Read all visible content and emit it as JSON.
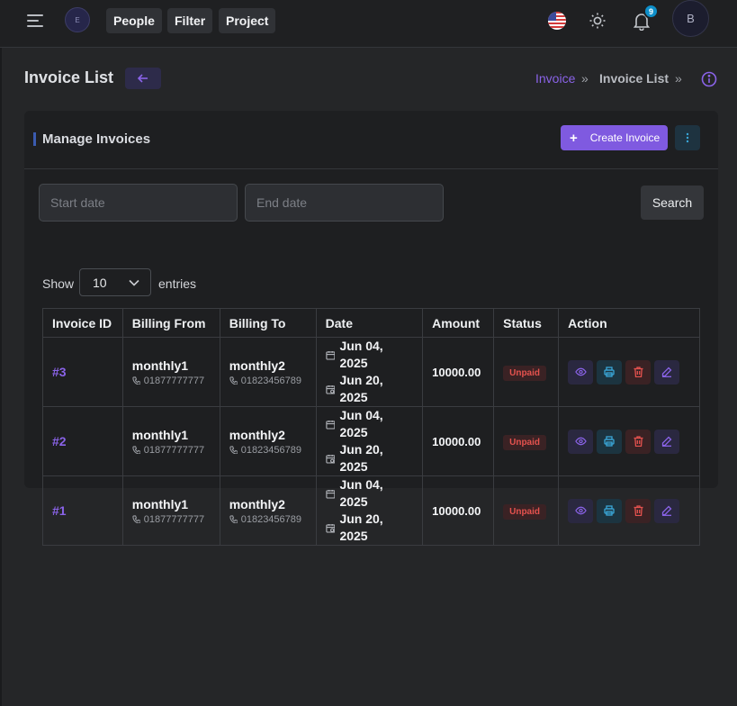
{
  "topbar": {
    "logo_text": "E",
    "nav": [
      "People",
      "Filter",
      "Project"
    ],
    "notification_count": "9",
    "avatar_initial": "B"
  },
  "page": {
    "title": "Invoice List",
    "breadcrumb": [
      "Invoice",
      "Invoice List"
    ],
    "breadcrumb_sep": "»"
  },
  "card": {
    "title": "Manage Invoices",
    "create_label": "Create Invoice",
    "start_placeholder": "Start date",
    "end_placeholder": "End date",
    "search_label": "Search",
    "show_label": "Show",
    "entries_value": "10",
    "entries_label": "entries"
  },
  "table": {
    "headers": [
      "Invoice ID",
      "Billing From",
      "Billing To",
      "Date",
      "Amount",
      "Status",
      "Action"
    ],
    "rows": [
      {
        "id": "#3",
        "from": "monthly1",
        "from_phone": "01877777777",
        "to": "monthly2",
        "to_phone": "01823456789",
        "date": "Jun 04, 2025",
        "due": "Jun 20, 2025",
        "amount": "10000.00",
        "status": "Unpaid"
      },
      {
        "id": "#2",
        "from": "monthly1",
        "from_phone": "01877777777",
        "to": "monthly2",
        "to_phone": "01823456789",
        "date": "Jun 04, 2025",
        "due": "Jun 20, 2025",
        "amount": "10000.00",
        "status": "Unpaid"
      },
      {
        "id": "#1",
        "from": "monthly1",
        "from_phone": "01877777777",
        "to": "monthly2",
        "to_phone": "01823456789",
        "date": "Jun 04, 2025",
        "due": "Jun 20, 2025",
        "amount": "10000.00",
        "status": "Unpaid"
      }
    ]
  },
  "colors": {
    "accent": "#7f5ae0",
    "link": "#8a63e8",
    "unpaid": "#e5524e",
    "background": "#252628",
    "card": "#1e1f21"
  },
  "icons": [
    "hamburger-icon",
    "us-flag-icon",
    "sun-icon",
    "bell-icon",
    "arrow-left-icon",
    "info-icon",
    "plus-icon",
    "vertical-dots-icon",
    "chevron-down-icon",
    "phone-icon",
    "calendar-icon",
    "calendar-clock-icon",
    "eye-icon",
    "printer-icon",
    "trash-icon",
    "pencil-icon"
  ]
}
